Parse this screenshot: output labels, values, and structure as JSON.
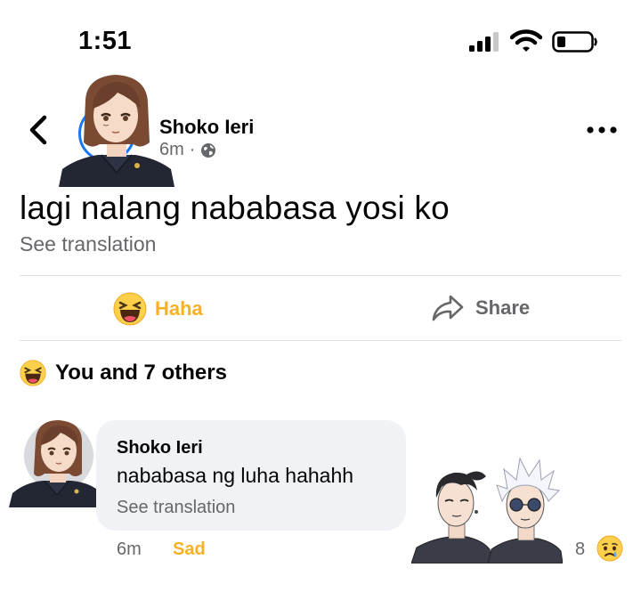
{
  "status_bar": {
    "time": "1:51"
  },
  "post": {
    "author": "Shoko Ieri",
    "time": "6m",
    "separator": "·",
    "text": "lagi nalang nababasa yosi ko",
    "see_translation": "See translation"
  },
  "actions": {
    "reaction_label": "Haha",
    "share_label": "Share"
  },
  "reactions_summary": {
    "label": "You and 7 others"
  },
  "comment": {
    "author": "Shoko Ieri",
    "text": "nababasa ng luha hahahh",
    "see_translation": "See translation",
    "time": "6m",
    "reaction_label": "Sad",
    "reaction_count": "8"
  },
  "colors": {
    "accent_blue": "#1877f2",
    "haha_yellow": "#f7b125",
    "secondary_text": "#65676b",
    "bubble_bg": "#f0f2f5"
  },
  "icons": [
    "back-icon",
    "more-icon",
    "globe-icon",
    "haha-icon",
    "share-icon",
    "sad-icon",
    "signal-icon",
    "wifi-icon",
    "battery-icon"
  ]
}
